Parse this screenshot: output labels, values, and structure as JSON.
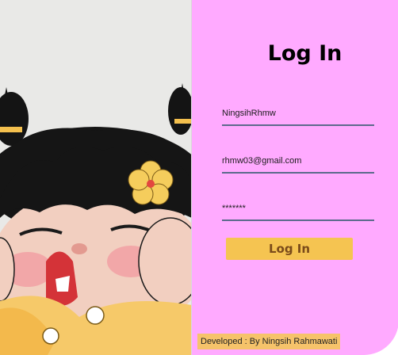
{
  "login": {
    "title": "Log In",
    "username_value": "NingsihRhmw",
    "email_value": "rhmw03@gmail.com",
    "password_value": "*******",
    "button_label": "Log In"
  },
  "footer": {
    "credit": "Developed : By Ningsih Rahmawati"
  },
  "colors": {
    "panel_bg": "#ffaaff",
    "button_bg": "#f5c451",
    "button_text": "#7a4b1a",
    "field_underline": "#5c6a8c",
    "credit_bg": "#f6c36a"
  },
  "icons": {
    "illustration": "cartoon-girl-face-illustration"
  }
}
